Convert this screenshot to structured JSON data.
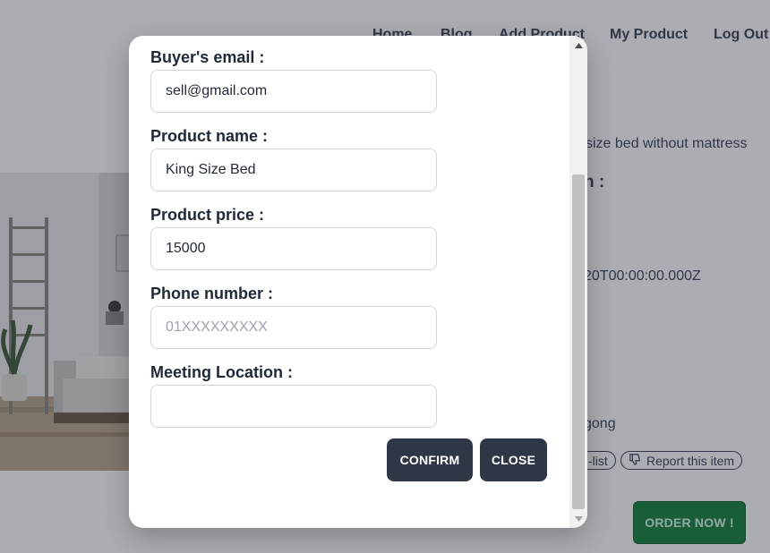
{
  "background": {
    "nav": {
      "items": [
        {
          "label": "Home"
        },
        {
          "label": "Blog"
        },
        {
          "label": "Add Product"
        },
        {
          "label": "My Product"
        },
        {
          "label": "Log Out"
        }
      ]
    },
    "fragments": {
      "description": "size bed without mattress",
      "heading_tail": "n :",
      "date_tail": "20T00:00:00.000Z",
      "location_tail": "gong"
    },
    "wishlist_pill_tail": "-list",
    "report_label": "Report this item",
    "order_button": "ORDER NOW !"
  },
  "modal": {
    "fields": [
      {
        "label": "Buyer's email :",
        "value": "sell@gmail.com",
        "placeholder": ""
      },
      {
        "label": "Product name :",
        "value": "King Size Bed",
        "placeholder": ""
      },
      {
        "label": "Product price :",
        "value": "15000",
        "placeholder": ""
      },
      {
        "label": "Phone number :",
        "value": "",
        "placeholder": "01XXXXXXXXX"
      },
      {
        "label": "Meeting Location :",
        "value": "",
        "placeholder": ""
      }
    ],
    "confirm_label": "CONFIRM",
    "close_label": "CLOSE"
  },
  "colors": {
    "modal_button": "#2f3747",
    "order_button": "#15803d",
    "overlay": "rgba(35,40,52,0.38)"
  }
}
